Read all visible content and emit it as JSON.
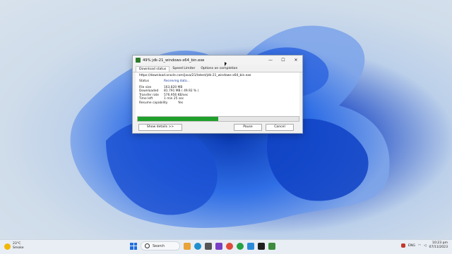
{
  "dialog": {
    "title": "49% jdk-21_windows-x64_bin.exe",
    "controls": {
      "minimize": "—",
      "maximize": "☐",
      "close": "✕"
    },
    "tabs": [
      "Download status",
      "Speed Limiter",
      "Options on completion"
    ],
    "url": "https://download.oracle.com/java/21/latest/jdk-21_windows-x64_bin.exe",
    "status": {
      "label": "Status",
      "value": "Receiving data..."
    },
    "fields": [
      {
        "label": "File size",
        "value": "163.820  MB"
      },
      {
        "label": "Downloaded",
        "value": "81.791  MB  ( 49.92 % )"
      },
      {
        "label": "Transfer rate",
        "value": "576.956  KB/sec"
      },
      {
        "label": "Time left",
        "value": "1 min 25 sec"
      },
      {
        "label": "Resume capability",
        "value": "Yes"
      }
    ],
    "progress_percent": 49.92,
    "buttons": {
      "details": "Show details >>",
      "pause": "Pause",
      "cancel": "Cancel"
    }
  },
  "taskbar": {
    "weather": {
      "temp": "23°C",
      "condition": "Smoke"
    },
    "search_placeholder": "Search",
    "tray": {
      "language": "ENG",
      "time": "10:23 pm",
      "date": "07/11/2023"
    }
  },
  "colors": {
    "progress": "#1fa02b",
    "status_blue": "#1a3fa0",
    "taskbar": "#e9eef4"
  },
  "icons": {
    "taskbar_apps": [
      "start-icon",
      "search-icon",
      "file-explorer-icon",
      "edge-icon",
      "store-icon",
      "mail-icon",
      "chrome-icon",
      "whatsapp-icon",
      "photos-icon",
      "app-icon",
      "app-icon"
    ]
  }
}
